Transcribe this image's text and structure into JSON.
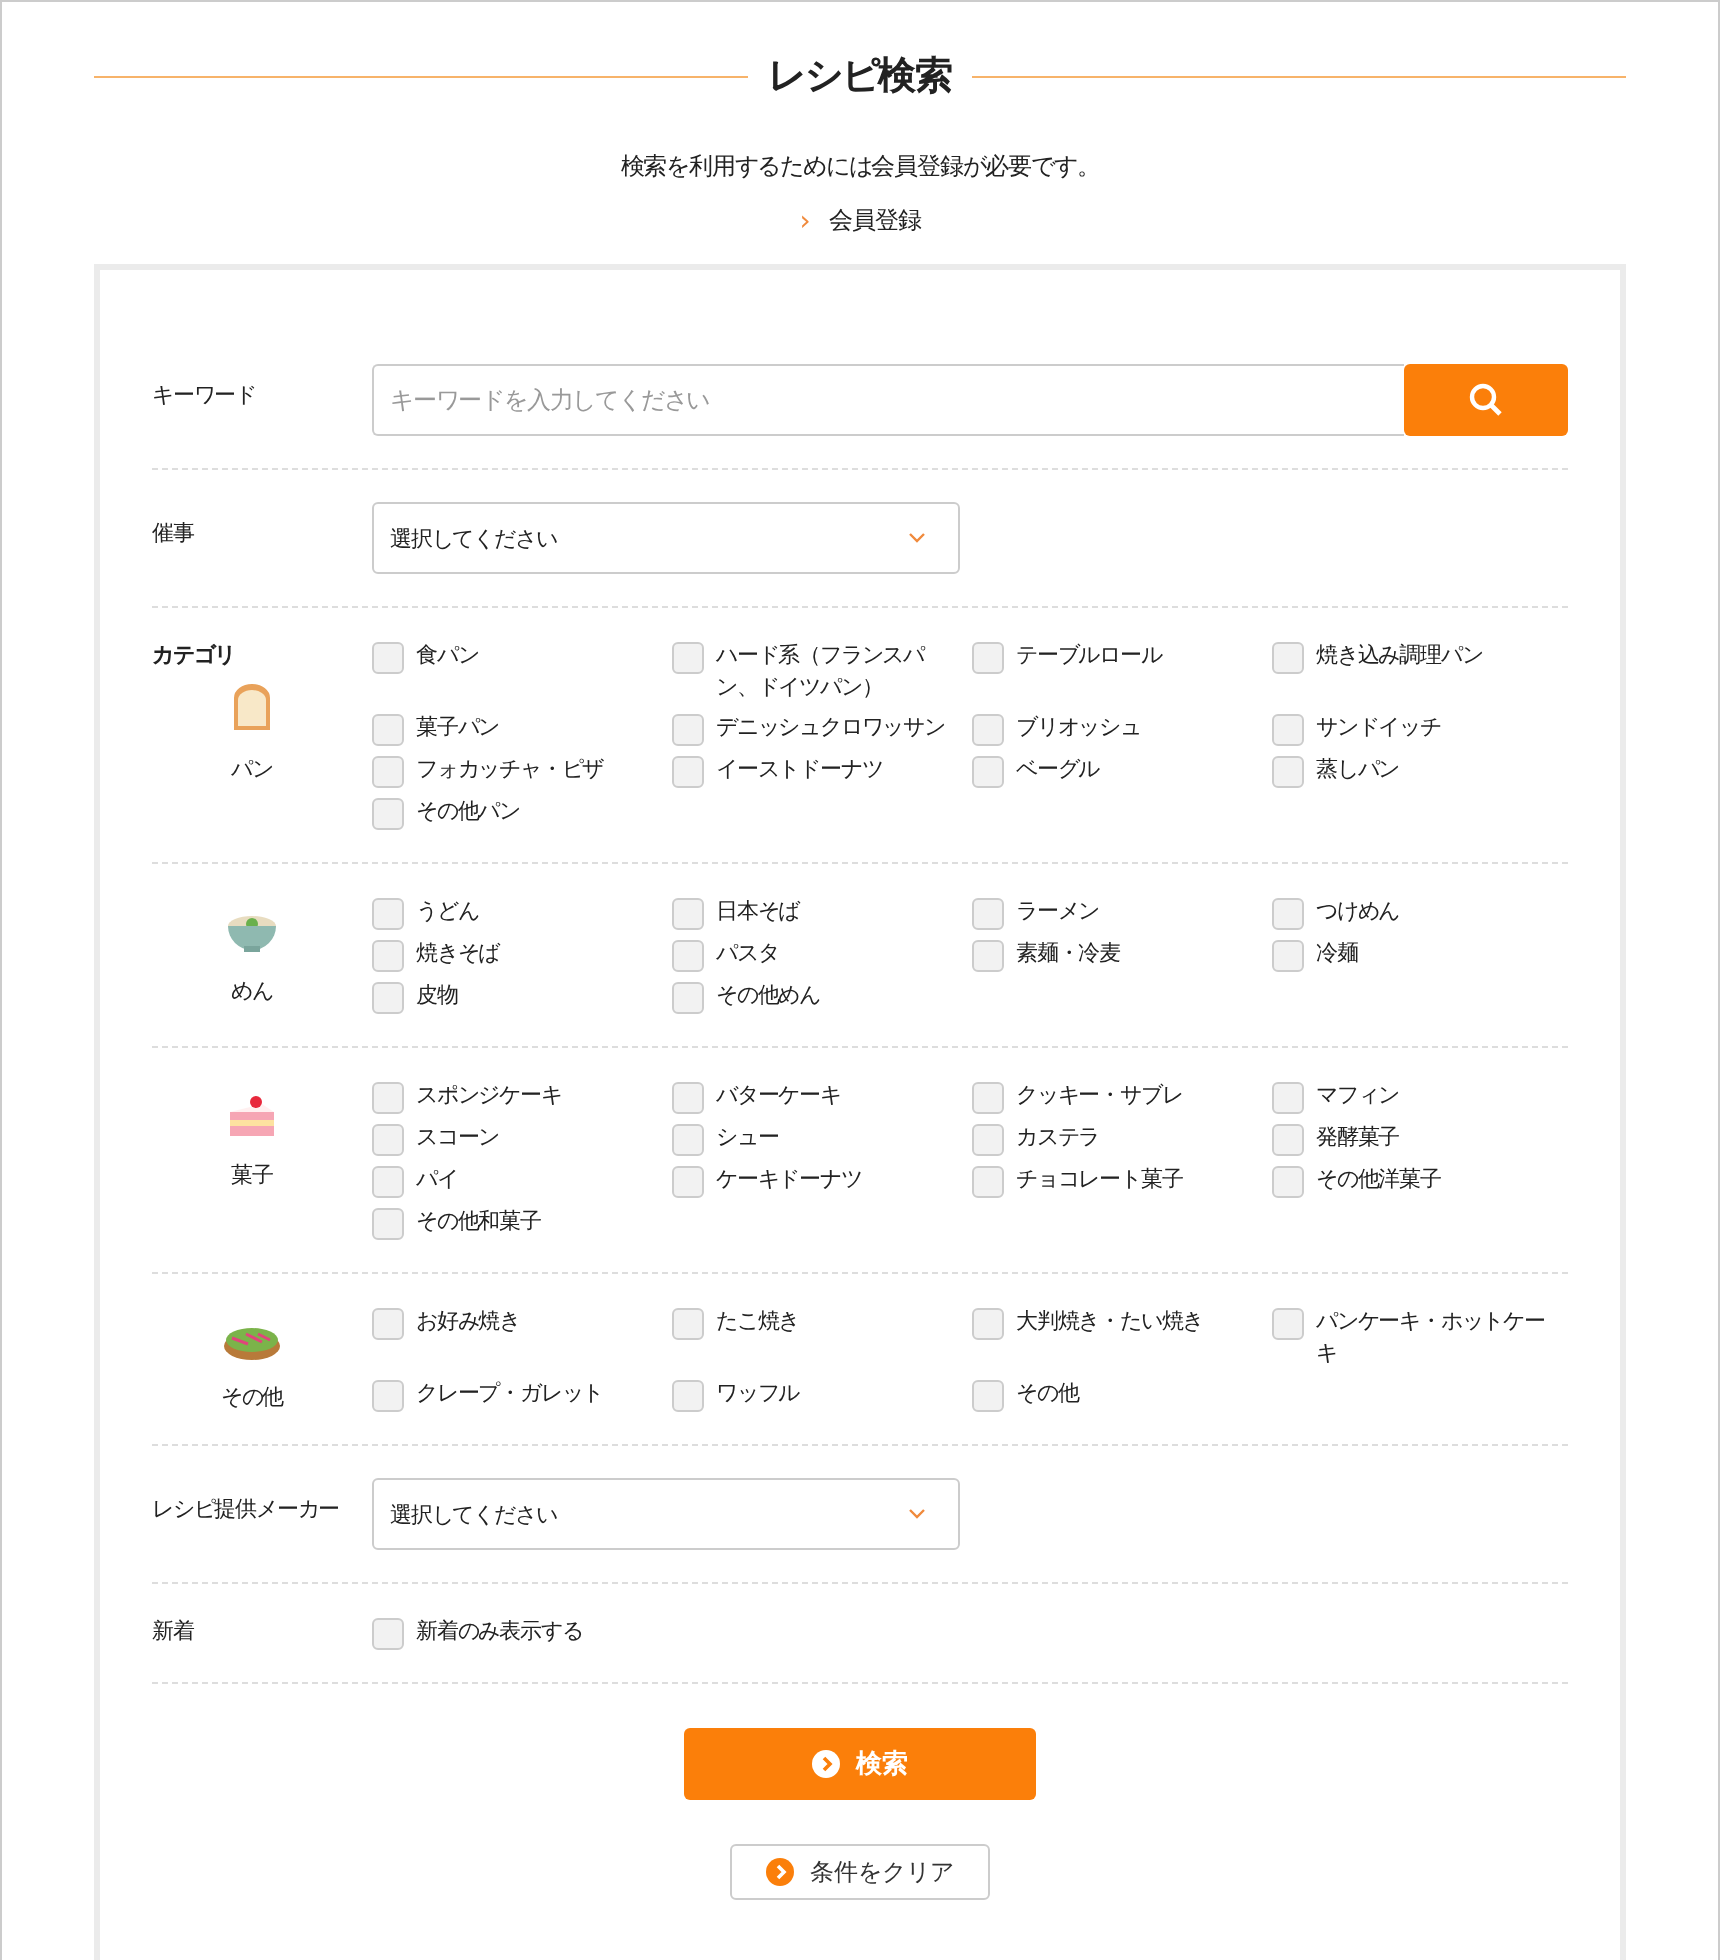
{
  "title": "レシピ検索",
  "notice": "検索を利用するためには会員登録が必要です。",
  "register_link": {
    "icon": "›",
    "label": "会員登録"
  },
  "keyword": {
    "label": "キーワード",
    "placeholder": "キーワードを入力してください"
  },
  "event": {
    "label": "催事",
    "value": "選択してください"
  },
  "category": {
    "label": "カテゴリ",
    "groups": [
      {
        "kind": "bread",
        "name": "パン",
        "items": [
          {
            "label": "食パン",
            "checked": false
          },
          {
            "label": "ハード系（フランスパン、ドイツパン）",
            "checked": false
          },
          {
            "label": "テーブルロール",
            "checked": false
          },
          {
            "label": "焼き込み調理パン",
            "checked": false
          },
          {
            "label": "菓子パン",
            "checked": false
          },
          {
            "label": "デニッシュクロワッサン",
            "checked": false
          },
          {
            "label": "ブリオッシュ",
            "checked": false
          },
          {
            "label": "サンドイッチ",
            "checked": false
          },
          {
            "label": "フォカッチャ・ピザ",
            "checked": false
          },
          {
            "label": "イーストドーナツ",
            "checked": false
          },
          {
            "label": "ベーグル",
            "checked": false
          },
          {
            "label": "蒸しパン",
            "checked": false
          },
          {
            "label": "その他パン",
            "checked": false
          }
        ]
      },
      {
        "kind": "noodles",
        "name": "めん",
        "items": [
          {
            "label": "うどん",
            "checked": false
          },
          {
            "label": "日本そば",
            "checked": false
          },
          {
            "label": "ラーメン",
            "checked": false
          },
          {
            "label": "つけめん",
            "checked": false
          },
          {
            "label": "焼きそば",
            "checked": false
          },
          {
            "label": "パスタ",
            "checked": false
          },
          {
            "label": "素麺・冷麦",
            "checked": false
          },
          {
            "label": "冷麺",
            "checked": false
          },
          {
            "label": "皮物",
            "checked": false
          },
          {
            "label": "その他めん",
            "checked": false
          }
        ]
      },
      {
        "kind": "cake",
        "name": "菓子",
        "items": [
          {
            "label": "スポンジケーキ",
            "checked": false
          },
          {
            "label": "バターケーキ",
            "checked": false
          },
          {
            "label": "クッキー・サブレ",
            "checked": false
          },
          {
            "label": "マフィン",
            "checked": false
          },
          {
            "label": "スコーン",
            "checked": false
          },
          {
            "label": "シュー",
            "checked": false
          },
          {
            "label": "カステラ",
            "checked": false
          },
          {
            "label": "発酵菓子",
            "checked": false
          },
          {
            "label": "パイ",
            "checked": false
          },
          {
            "label": "ケーキドーナツ",
            "checked": false
          },
          {
            "label": "チョコレート菓子",
            "checked": false
          },
          {
            "label": "その他洋菓子",
            "checked": false
          },
          {
            "label": "その他和菓子",
            "checked": false
          }
        ]
      },
      {
        "kind": "griddle",
        "name": "その他",
        "items": [
          {
            "label": "お好み焼き",
            "checked": false
          },
          {
            "label": "たこ焼き",
            "checked": false
          },
          {
            "label": "大判焼き・たい焼き",
            "checked": false
          },
          {
            "label": "パンケーキ・ホットケーキ",
            "checked": false
          },
          {
            "label": "クレープ・ガレット",
            "checked": false
          },
          {
            "label": "ワッフル",
            "checked": false
          },
          {
            "label": "その他",
            "checked": false
          }
        ]
      }
    ]
  },
  "maker": {
    "label": "レシピ提供メーカー",
    "value": "選択してください"
  },
  "new_arrivals": {
    "label": "新着",
    "option": {
      "label": "新着のみ表示する",
      "checked": false
    }
  },
  "search_button": "検索",
  "clear_button": "条件をクリア"
}
